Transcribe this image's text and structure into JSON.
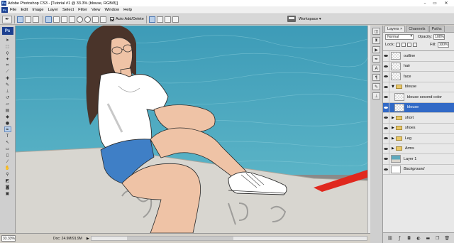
{
  "window": {
    "title": "Adobe Photoshop CS3 - [Tutorial #1 @ 33.3% (blouse, RGB/8)]",
    "app_icon": "Ps",
    "minimize_icon": "minimize-icon",
    "maximize_icon": "maximize-icon",
    "close_icon": "close-icon"
  },
  "menu": {
    "logo": "Ps",
    "items": [
      "File",
      "Edit",
      "Image",
      "Layer",
      "Select",
      "Filter",
      "View",
      "Window",
      "Help"
    ]
  },
  "options_bar": {
    "auto_add_delete": {
      "label": "Auto Add/Delete",
      "checked": true
    },
    "workspace_label": "Workspace ▾"
  },
  "tools": {
    "logo": "Ps",
    "active": "pen-tool"
  },
  "status_bar": {
    "zoom": "33.33%",
    "doc": "Doc: 24.9M/91.9M"
  },
  "layers_panel": {
    "tabs": [
      "Layers ×",
      "Channels",
      "Paths"
    ],
    "blend_mode": "Normal",
    "opacity_label": "Opacity:",
    "opacity_value": "100%",
    "lock_label": "Lock:",
    "fill_label": "Fill:",
    "fill_value": "100%",
    "layers": [
      {
        "name": "outline",
        "kind": "layer",
        "indent": 0,
        "italic": false,
        "selected": false
      },
      {
        "name": "hair",
        "kind": "layer",
        "indent": 0,
        "italic": false,
        "selected": false
      },
      {
        "name": "face",
        "kind": "layer",
        "indent": 0,
        "italic": false,
        "selected": false
      },
      {
        "name": "blouse",
        "kind": "group-open",
        "indent": 0,
        "italic": false,
        "selected": false
      },
      {
        "name": "blouse second color",
        "kind": "layer",
        "indent": 1,
        "italic": false,
        "selected": false
      },
      {
        "name": "blouse",
        "kind": "layer",
        "indent": 1,
        "italic": false,
        "selected": true
      },
      {
        "name": "short",
        "kind": "group",
        "indent": 0,
        "italic": false,
        "selected": false
      },
      {
        "name": "shoes",
        "kind": "group",
        "indent": 0,
        "italic": false,
        "selected": false
      },
      {
        "name": "Leg",
        "kind": "group",
        "indent": 0,
        "italic": false,
        "selected": false
      },
      {
        "name": "Arms",
        "kind": "group",
        "indent": 0,
        "italic": false,
        "selected": false
      },
      {
        "name": "Layer 1",
        "kind": "photo",
        "indent": 0,
        "italic": false,
        "selected": false
      },
      {
        "name": "Background",
        "kind": "background",
        "indent": 0,
        "italic": true,
        "selected": false
      }
    ]
  },
  "colors": {
    "water": "#4aa3bd",
    "wall": "#d8d6d0",
    "selection": "#3169c6",
    "shorts": "#3f7fc6",
    "skin": "#efc3a6"
  }
}
